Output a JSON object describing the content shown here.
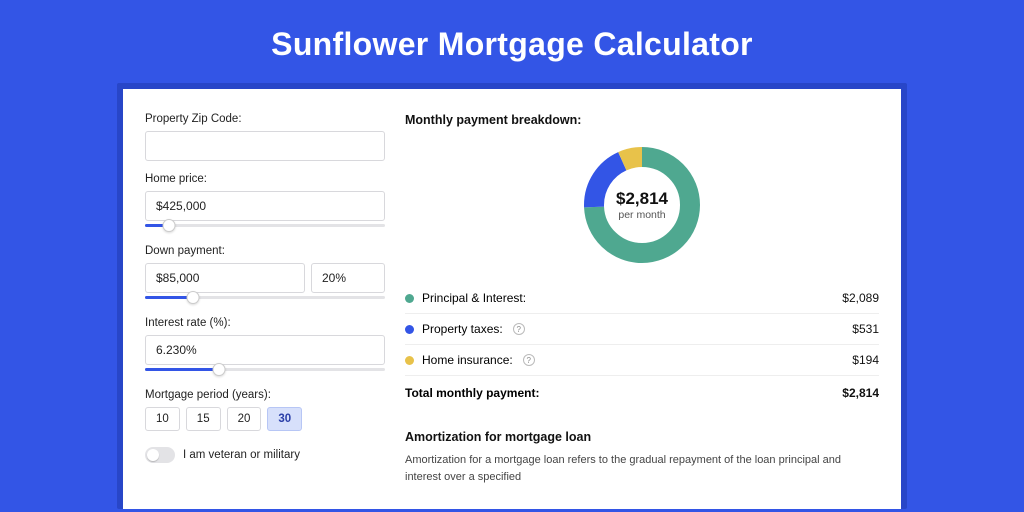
{
  "title": "Sunflower Mortgage Calculator",
  "form": {
    "zip_label": "Property Zip Code:",
    "zip_value": "",
    "home_price_label": "Home price:",
    "home_price_value": "$425,000",
    "home_price_slider_pct": 10,
    "down_payment_label": "Down payment:",
    "down_payment_value": "$85,000",
    "down_payment_pct_value": "20%",
    "down_payment_slider_pct": 20,
    "interest_label": "Interest rate (%):",
    "interest_value": "6.230%",
    "interest_slider_pct": 31,
    "period_label": "Mortgage period (years):",
    "period_options": [
      "10",
      "15",
      "20",
      "30"
    ],
    "period_selected": "30",
    "veteran_label": "I am veteran or military",
    "veteran_on": false
  },
  "breakdown": {
    "title": "Monthly payment breakdown:",
    "donut_amount": "$2,814",
    "donut_sub": "per month",
    "items": [
      {
        "label": "Principal & Interest:",
        "value": "$2,089",
        "color": "green",
        "pct": 74.2,
        "info": false
      },
      {
        "label": "Property taxes:",
        "value": "$531",
        "color": "blue",
        "pct": 18.9,
        "info": true
      },
      {
        "label": "Home insurance:",
        "value": "$194",
        "color": "yellow",
        "pct": 6.9,
        "info": true
      }
    ],
    "total_label": "Total monthly payment:",
    "total_value": "$2,814"
  },
  "amortization": {
    "title": "Amortization for mortgage loan",
    "text": "Amortization for a mortgage loan refers to the gradual repayment of the loan principal and interest over a specified"
  },
  "chart_data": {
    "type": "pie",
    "title": "Monthly payment breakdown",
    "series": [
      {
        "name": "Principal & Interest",
        "value": 2089,
        "pct": 74.2,
        "color": "#4fa890"
      },
      {
        "name": "Property taxes",
        "value": 531,
        "pct": 18.9,
        "color": "#3355e6"
      },
      {
        "name": "Home insurance",
        "value": 194,
        "pct": 6.9,
        "color": "#e8c24a"
      }
    ],
    "total": 2814,
    "center_label": "$2,814 per month"
  }
}
